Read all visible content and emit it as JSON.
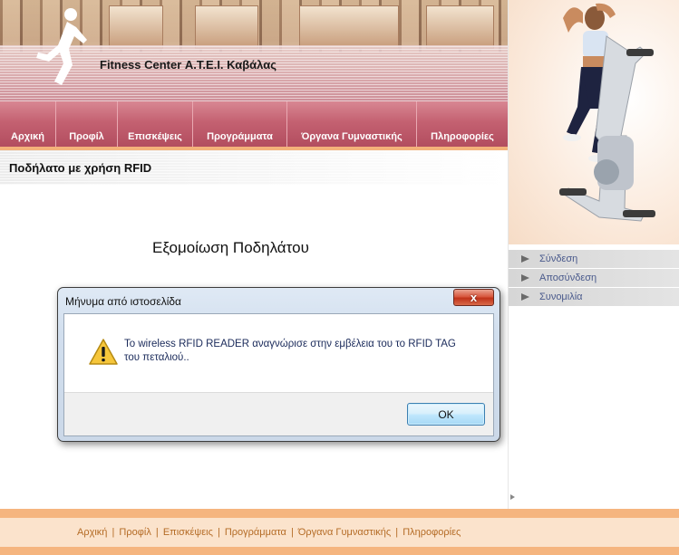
{
  "header": {
    "site_title": "Fitness Center Α.Τ.Ε.Ι. Καβάλας"
  },
  "nav": {
    "items": [
      {
        "label": "Αρχική"
      },
      {
        "label": "Προφίλ"
      },
      {
        "label": "Επισκέψεις"
      },
      {
        "label": "Προγράμματα"
      },
      {
        "label": "Όργανα Γυμναστικής"
      },
      {
        "label": "Πληροφορίες"
      }
    ]
  },
  "page": {
    "subtitle": "Ποδήλατο με χρήση RFID",
    "heading": "Εξομοίωση Ποδηλάτου"
  },
  "side_menu": {
    "items": [
      {
        "label": "Σύνδεση"
      },
      {
        "label": "Αποσύνδεση"
      },
      {
        "label": "Συνομιλία"
      }
    ]
  },
  "footer": {
    "links": [
      "Αρχική",
      "Προφίλ",
      "Επισκέψεις",
      "Προγράμματα",
      "Όργανα Γυμναστικής",
      "Πληροφορίες"
    ],
    "separator": "|"
  },
  "dialog": {
    "title": "Μήνυμα από ιστοσελίδα",
    "message_line1": "Το wireless RFID READER αναγνώρισε στην εμβέλεια του το RFID TAG",
    "message_line2": "του πεταλιού..",
    "ok_label": "OK",
    "close_symbol": "x",
    "icon": "warning-icon"
  },
  "colors": {
    "nav_gradient_top": "#d88793",
    "nav_gradient_bottom": "#b24d5f",
    "footer_accent": "#f5b57f",
    "footer_link": "#b46b25",
    "side_link": "#4a5a8c"
  }
}
